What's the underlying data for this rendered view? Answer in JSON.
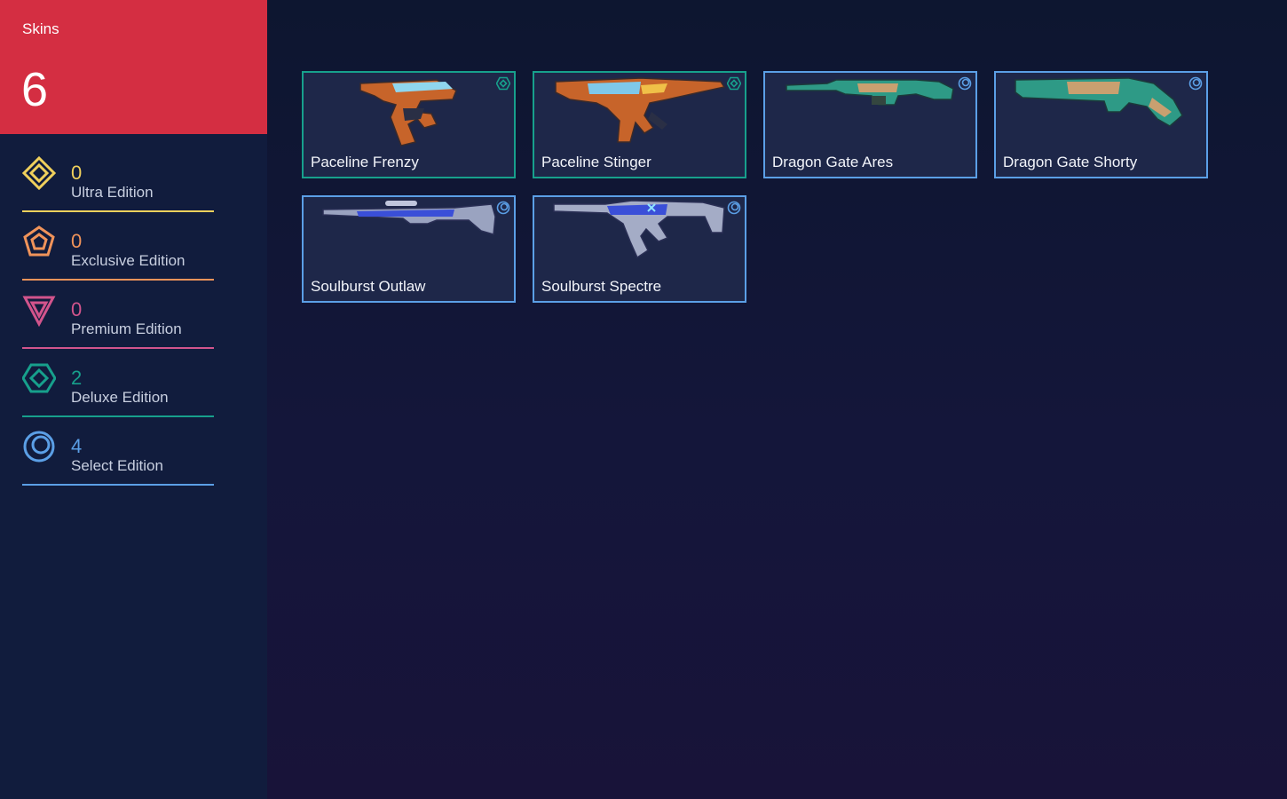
{
  "summary": {
    "label": "Skins",
    "total": "6"
  },
  "tiers": [
    {
      "key": "ultra",
      "count": "0",
      "name": "Ultra Edition",
      "color": "#f0d05c",
      "icon": "ultra-edition-icon"
    },
    {
      "key": "exclusive",
      "count": "0",
      "name": "Exclusive Edition",
      "color": "#f0935a",
      "icon": "exclusive-edition-icon"
    },
    {
      "key": "premium",
      "count": "0",
      "name": "Premium Edition",
      "color": "#d2548c",
      "icon": "premium-edition-icon"
    },
    {
      "key": "deluxe",
      "count": "2",
      "name": "Deluxe Edition",
      "color": "#17a08c",
      "icon": "deluxe-edition-icon"
    },
    {
      "key": "select",
      "count": "4",
      "name": "Select Edition",
      "color": "#5b9fe6",
      "icon": "select-edition-icon"
    }
  ],
  "skins": [
    {
      "name": "Paceline Frenzy",
      "tier": "deluxe",
      "weapon": "pistol"
    },
    {
      "name": "Paceline Stinger",
      "tier": "deluxe",
      "weapon": "smg"
    },
    {
      "name": "Dragon Gate Ares",
      "tier": "select",
      "weapon": "lmg"
    },
    {
      "name": "Dragon Gate Shorty",
      "tier": "select",
      "weapon": "shotgun"
    },
    {
      "name": "Soulburst Outlaw",
      "tier": "select",
      "weapon": "sniper"
    },
    {
      "name": "Soulburst Spectre",
      "tier": "select",
      "weapon": "smg2"
    }
  ]
}
